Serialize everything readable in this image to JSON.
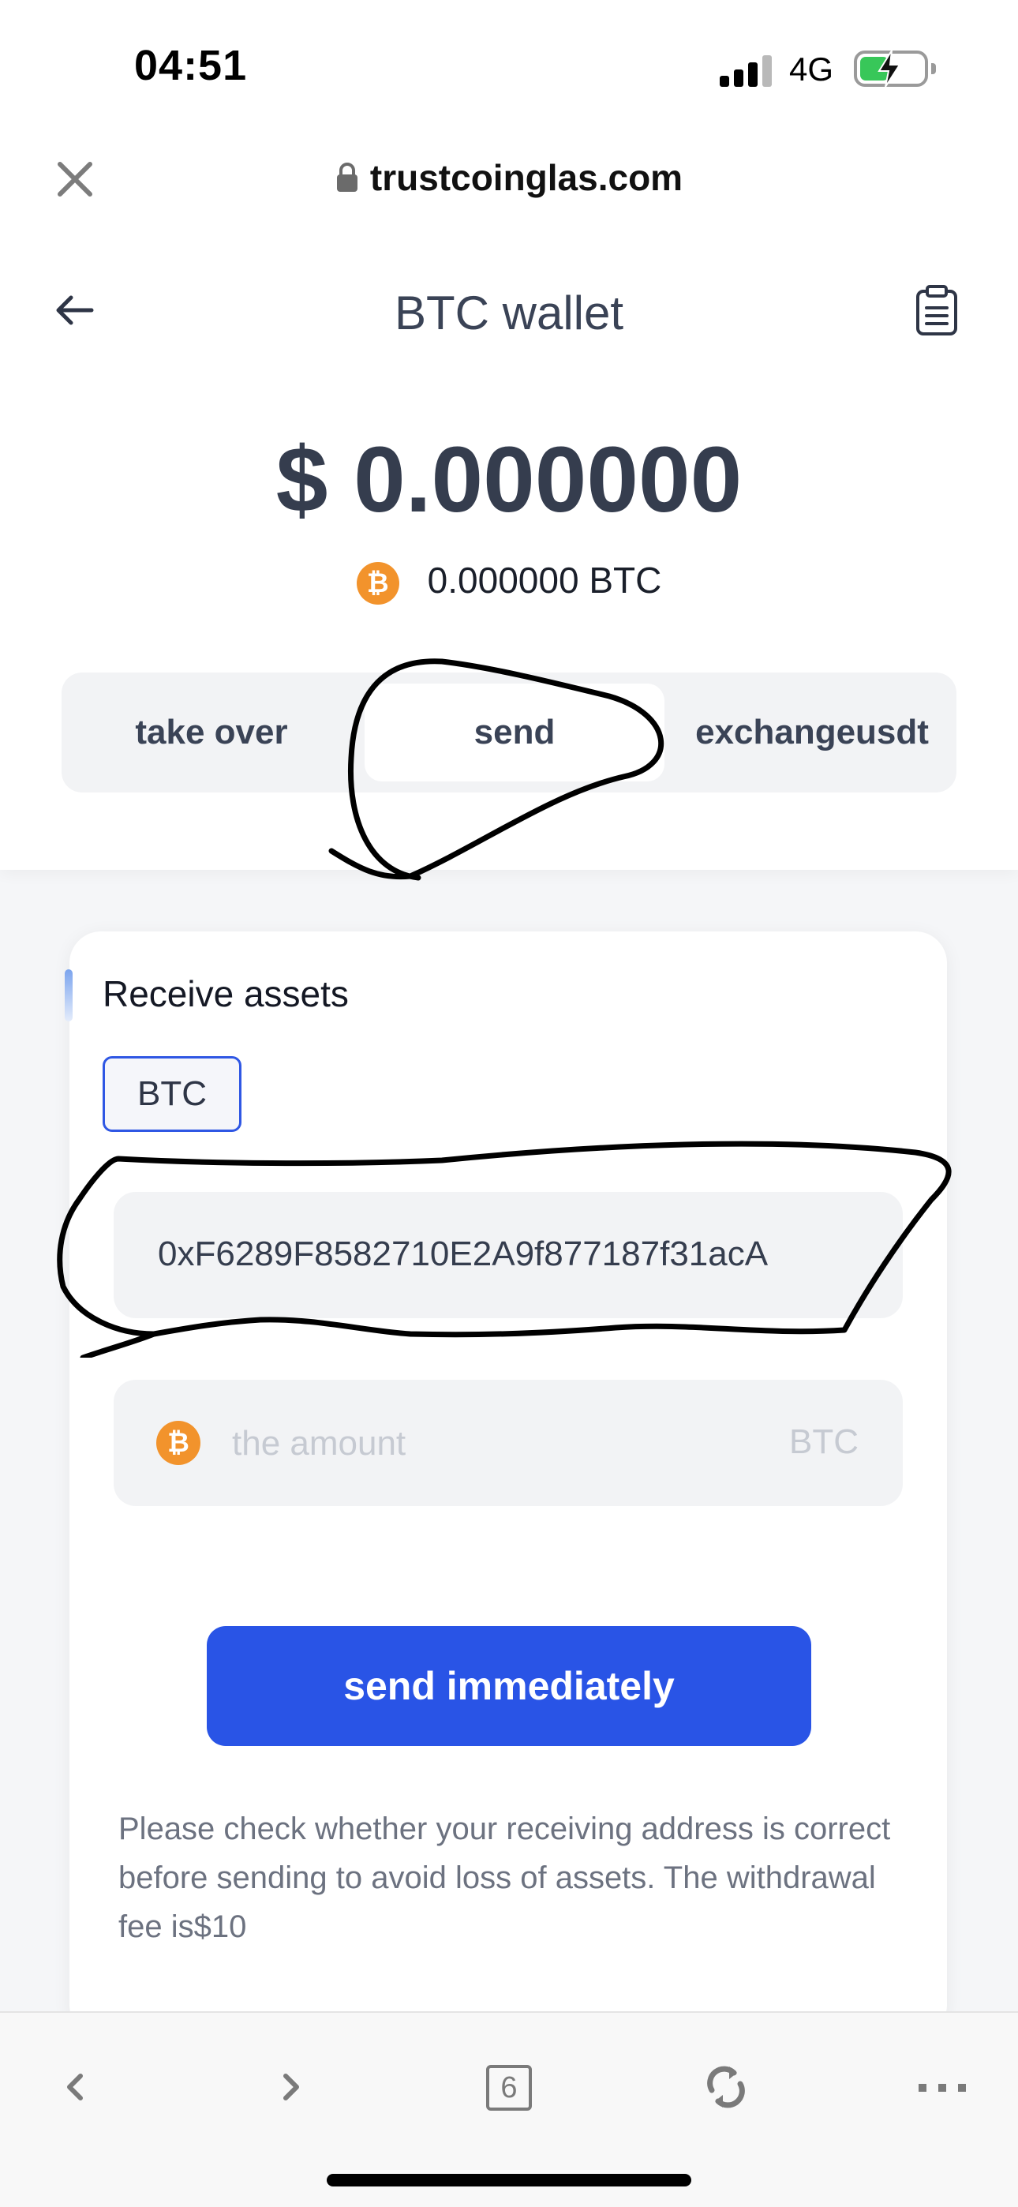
{
  "status_bar": {
    "time": "04:51",
    "network": "4G"
  },
  "browser": {
    "url": "trustcoinglas.com",
    "tab_count": "6"
  },
  "header": {
    "title": "BTC wallet"
  },
  "balance": {
    "usd": "$ 0.000000",
    "btc": "0.000000 BTC"
  },
  "tabs": [
    {
      "label": "take over"
    },
    {
      "label": "send",
      "selected": true
    },
    {
      "label": "exchangeusdt"
    }
  ],
  "card": {
    "title": "Receive assets",
    "coin_chip": "BTC",
    "address": "0xF6289F8582710E2A9f877187f31acA",
    "amount_placeholder": "the amount",
    "amount_unit": "BTC",
    "send_label": "send immediately",
    "notice": "Please check whether your receiving address is correct before sending to avoid loss of assets. The withdrawal fee is$10"
  },
  "icons": {
    "close": "close-icon",
    "lock": "lock-icon",
    "back": "back-arrow-icon",
    "clipboard": "clipboard-icon",
    "bitcoin": "bitcoin-icon",
    "toolbar": [
      "chevron-left-icon",
      "chevron-right-icon",
      "tabs-icon",
      "reload-icon",
      "more-icon"
    ]
  },
  "colors": {
    "accent": "#2954e6",
    "bitcoin": "#f2932c",
    "battery": "#38c759"
  }
}
